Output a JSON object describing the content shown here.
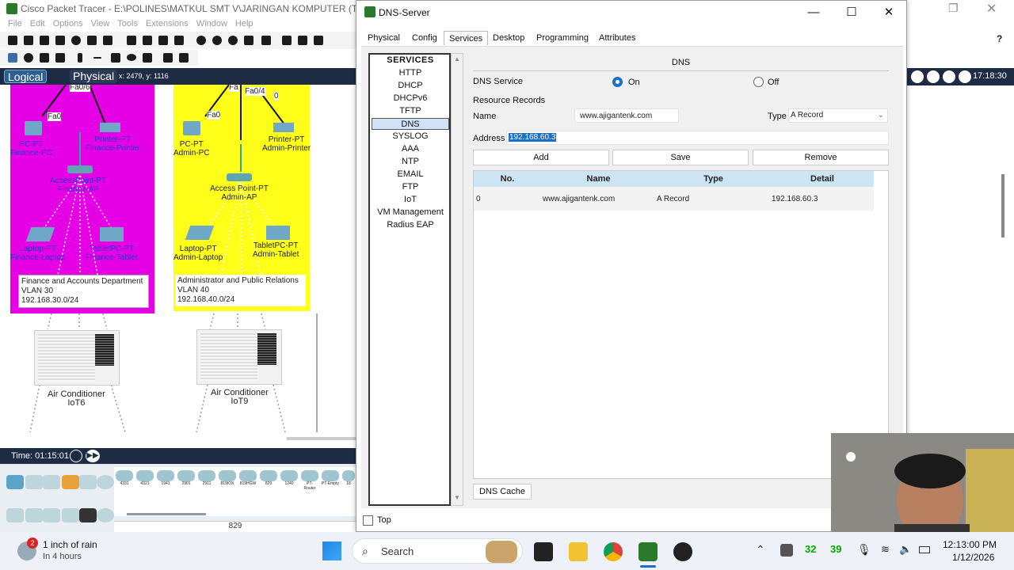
{
  "app": {
    "title": "Cisco Packet Tracer - E:\\POLINES\\MATKUL SMT V\\JARINGAN KOMPUTER (T-P)\\FI",
    "menu": [
      "File",
      "Edit",
      "Options",
      "View",
      "Tools",
      "Extensions",
      "Window",
      "Help"
    ],
    "mode_logical": "Logical",
    "mode_physical": "Physical",
    "coords": "x: 2479, y: 1116",
    "time": "Time: 01:15:01",
    "clock": "17:18:30",
    "scroll_count": "829",
    "devices_strip": [
      "4331",
      "4321",
      "1941",
      "2901",
      "2911",
      "819IOX",
      "819HGW",
      "829",
      "1240",
      "PT-Router",
      "PT-Empty",
      "18"
    ]
  },
  "workspace": {
    "finance": {
      "ports": [
        "Fa0/6",
        "Fa0"
      ],
      "pc": "PC-PT\nFinance-PC",
      "printer": "Printer-PT\nFinance-Printer",
      "ap": "AccessPoint-PT\nFinance-AP",
      "laptop": "Laptop-PT\nFinance-Laptop",
      "tablet": "TabletPC-PT\nFinance-Tablet",
      "box_line1": "Finance and Accounts Department",
      "box_line2": "VLAN 30",
      "box_line3": "192.168.30.0/24",
      "ac": "Air Conditioner\nIoT6"
    },
    "admin": {
      "ports": [
        "Fa0/4",
        "Fa0",
        "0"
      ],
      "pc": "PC-PT\nAdmin-PC",
      "printer": "Printer-PT\nAdmin-Printer",
      "ap": "Access Point-PT\nAdmin-AP",
      "laptop": "Laptop-PT\nAdmin-Laptop",
      "tablet": "TabletPC-PT\nAdmin-Tablet",
      "box_line1": "Administrator and Public Relations",
      "box_line2": "VLAN 40",
      "box_line3": "192.168.40.0/24",
      "ac": "Air Conditioner\nIoT9"
    }
  },
  "dialog": {
    "title": "DNS-Server",
    "tabs": [
      "Physical",
      "Config",
      "Services",
      "Desktop",
      "Programming",
      "Attributes"
    ],
    "services": [
      "SERVICES",
      "HTTP",
      "DHCP",
      "DHCPv6",
      "TFTP",
      "DNS",
      "SYSLOG",
      "AAA",
      "NTP",
      "EMAIL",
      "FTP",
      "IoT",
      "VM Management",
      "Radius EAP"
    ],
    "panel_title": "DNS",
    "dns_service_label": "DNS Service",
    "on": "On",
    "off": "Off",
    "resource_records": "Resource Records",
    "name_label": "Name",
    "name_value": "www.ajigantenk.com",
    "type_label": "Type",
    "type_value": "A Record",
    "address_label": "Address",
    "address_value": "192.168.60.3",
    "add": "Add",
    "save": "Save",
    "remove": "Remove",
    "table_headers": [
      "No.",
      "Name",
      "Type",
      "Detail"
    ],
    "rows": [
      {
        "no": "0",
        "name": "www.ajigantenk.com",
        "type": "A Record",
        "detail": "192.168.60.3"
      }
    ],
    "dns_cache": "DNS Cache",
    "top_label": "Top"
  },
  "taskbar": {
    "weather_badge": "2",
    "weather_line1": "1 inch of rain",
    "weather_line2": "In 4 hours",
    "search": "Search",
    "num1": "32",
    "num2": "39",
    "time": "12:13:00 PM",
    "date": "1/12/2026"
  },
  "colors": {
    "finance_zone": "#e600e6",
    "admin_zone": "#ffff1a",
    "dark_bar": "#1d2b45",
    "selected_tab": "#1a6fc9"
  }
}
